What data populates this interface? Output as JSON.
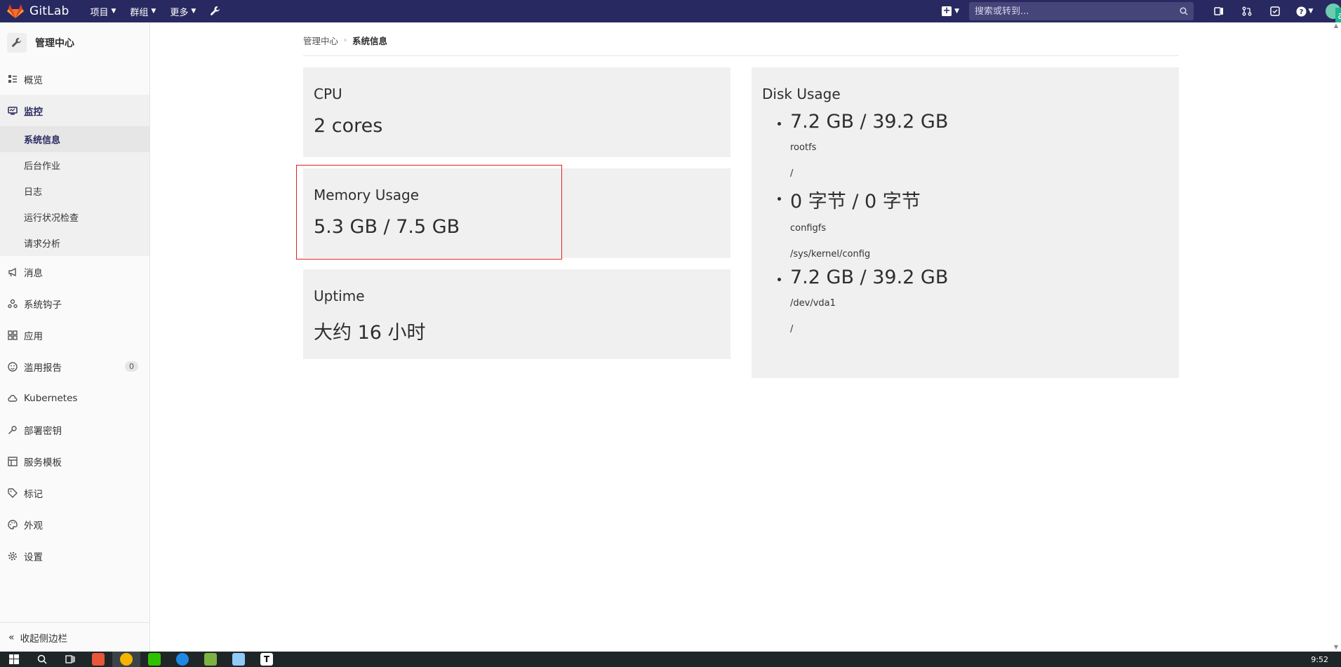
{
  "navbar": {
    "brand": "GitLab",
    "menus": [
      "项目",
      "群组",
      "更多"
    ],
    "search_placeholder": "搜索或转到...",
    "avatar_badge": "ae"
  },
  "sidebar": {
    "header": "管理中心",
    "items": [
      {
        "label": "概览",
        "icon": "overview-icon"
      },
      {
        "label": "监控",
        "icon": "monitor-icon"
      },
      {
        "label": "消息",
        "icon": "megaphone-icon"
      },
      {
        "label": "系统钩子",
        "icon": "hook-icon"
      },
      {
        "label": "应用",
        "icon": "apps-icon"
      },
      {
        "label": "滥用报告",
        "icon": "smiley-icon",
        "badge": "0"
      },
      {
        "label": "Kubernetes",
        "icon": "cloud-icon"
      },
      {
        "label": "部署密钥",
        "icon": "key-icon"
      },
      {
        "label": "服务模板",
        "icon": "template-icon"
      },
      {
        "label": "标记",
        "icon": "label-icon"
      },
      {
        "label": "外观",
        "icon": "palette-icon"
      },
      {
        "label": "设置",
        "icon": "gear-icon"
      }
    ],
    "submenu": [
      "系统信息",
      "后台作业",
      "日志",
      "运行状况检查",
      "请求分析"
    ],
    "collapse": "收起侧边栏"
  },
  "breadcrumb": {
    "parent": "管理中心",
    "current": "系统信息"
  },
  "cards": {
    "cpu": {
      "title": "CPU",
      "value": "2 cores"
    },
    "memory": {
      "title": "Memory Usage",
      "value": "5.3 GB / 7.5 GB"
    },
    "uptime": {
      "title": "Uptime",
      "value": "大约 16 小时"
    }
  },
  "disk": {
    "title": "Disk Usage",
    "entries": [
      {
        "size": "7.2 GB / 39.2 GB",
        "device": "rootfs",
        "mount": "/"
      },
      {
        "size": "0 字节 / 0 字节",
        "device": "configfs",
        "mount": "/sys/kernel/config"
      },
      {
        "size": "7.2 GB / 39.2 GB",
        "device": "/dev/vda1",
        "mount": "/"
      }
    ]
  },
  "taskbar": {
    "clock": "9:52"
  }
}
